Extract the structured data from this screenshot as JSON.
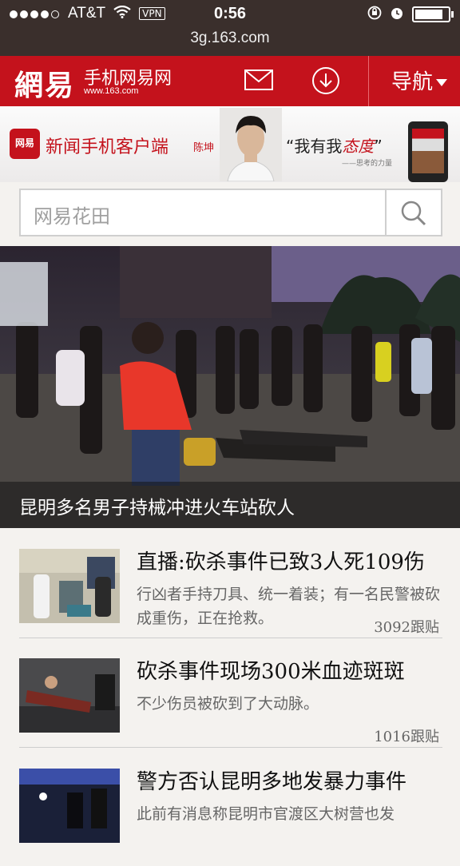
{
  "status_bar": {
    "carrier": "AT&T",
    "vpn": "VPN",
    "time": "0:56",
    "battery_level": 0.95
  },
  "url": "3g.163.com",
  "header": {
    "logo": "網易",
    "site_name": "手机网易网",
    "site_url": "www.163.com",
    "nav_label": "导航"
  },
  "banner": {
    "logo_text": "网易",
    "title": "新闻手机客户端",
    "name": "陈坤",
    "quote_prefix": "“我有我",
    "quote_emph": "态度",
    "quote_suffix": "”",
    "slogan": "——思考的力量"
  },
  "search": {
    "placeholder": "网易花田"
  },
  "headline": {
    "caption": "昆明多名男子持械冲进火车站砍人"
  },
  "news": [
    {
      "title": "直播:砍杀事件已致3人死109伤",
      "summary": "行凶者手持刀具、统一着装；有一名民警被砍成重伤，正在抢救。",
      "comments": "3092跟贴"
    },
    {
      "title": "砍杀事件现场300米血迹斑斑",
      "summary": "不少伤员被砍到了大动脉。",
      "comments": "1016跟贴"
    },
    {
      "title": "警方否认昆明多地发暴力事件",
      "summary": "此前有消息称昆明市官渡区大树营也发",
      "comments": ""
    }
  ],
  "colors": {
    "brand": "#c4121c",
    "status_bar": "#3a2f2c"
  }
}
